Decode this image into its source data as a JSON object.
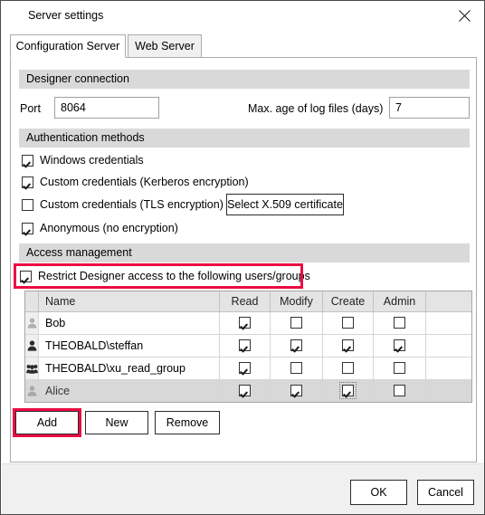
{
  "window": {
    "title": "Server settings",
    "close_icon": "close-icon"
  },
  "tabs": [
    {
      "label": "Configuration Server",
      "active": true
    },
    {
      "label": "Web Server",
      "active": false
    }
  ],
  "groups": {
    "designer_connection": {
      "header": "Designer connection",
      "port_label": "Port",
      "port_value": "8064",
      "max_age_label": "Max. age of log files (days)",
      "max_age_value": "7"
    },
    "authentication_methods": {
      "header": "Authentication methods",
      "options": [
        {
          "label": "Windows credentials",
          "checked": true
        },
        {
          "label": "Custom credentials (Kerberos encryption)",
          "checked": true
        },
        {
          "label": "Custom credentials (TLS encryption)",
          "checked": false
        },
        {
          "label": "Anonymous (no encryption)",
          "checked": true
        }
      ],
      "arrow": "→",
      "certificate_button": "Select X.509 certificate"
    },
    "access_management": {
      "header": "Access management",
      "restrict_label": "Restrict Designer access to the following users/groups",
      "restrict_checked": true
    }
  },
  "grid": {
    "columns": [
      "Name",
      "Read",
      "Modify",
      "Create",
      "Admin"
    ],
    "rows": [
      {
        "icon": "user-icon-disabled",
        "name": "Bob",
        "read": true,
        "modify": false,
        "create": false,
        "admin": false,
        "selected": false
      },
      {
        "icon": "user-icon",
        "name": "THEOBALD\\steffan",
        "read": true,
        "modify": true,
        "create": true,
        "admin": true,
        "selected": false
      },
      {
        "icon": "group-icon",
        "name": "THEOBALD\\xu_read_group",
        "read": true,
        "modify": false,
        "create": false,
        "admin": false,
        "selected": false
      },
      {
        "icon": "user-icon-disabled",
        "name": "Alice",
        "read": true,
        "modify": true,
        "create": true,
        "admin": false,
        "selected": true
      }
    ]
  },
  "grid_buttons": {
    "add": "Add",
    "new": "New",
    "remove": "Remove"
  },
  "dialog_buttons": {
    "ok": "OK",
    "cancel": "Cancel"
  },
  "highlights": {
    "accent_color": "#ec0b43"
  }
}
